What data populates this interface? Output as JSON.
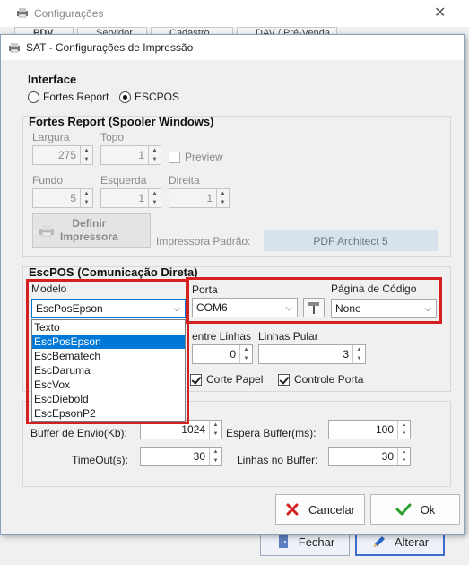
{
  "bg": {
    "title": "Configurações",
    "tabs": [
      "PDV",
      "Servidor",
      "Cadastro",
      "DAV / Pré-Venda"
    ],
    "buttons": {
      "close": "Fechar",
      "edit": "Alterar"
    }
  },
  "dialog": {
    "title": "SAT - Configurações de Impressão",
    "interface": {
      "title": "Interface",
      "options": [
        "Fortes Report",
        "ESCPOS"
      ],
      "selected": "ESCPOS"
    },
    "fortes": {
      "title": "Fortes Report (Spooler Windows)",
      "largura_label": "Largura",
      "largura": "275",
      "topo_label": "Topo",
      "topo": "1",
      "preview_label": "Preview",
      "fundo_label": "Fundo",
      "fundo": "5",
      "esquerda_label": "Esquerda",
      "esquerda": "1",
      "direita_label": "Direita",
      "direita": "1",
      "definir_label": "Definir\nImpressora",
      "padrao_label": "Impressora Padrão:",
      "padrao_value": "PDF Architect 5"
    },
    "escpos": {
      "title": "EscPOS (Comunicação Direta)",
      "modelo_label": "Modelo",
      "modelo_value": "EscPosEpson",
      "modelo_options": [
        "Texto",
        "EscPosEpson",
        "EscBematech",
        "EscDaruma",
        "EscVox",
        "EscDiebold",
        "EscEpsonP2"
      ],
      "modelo_selected_index": 1,
      "porta_label": "Porta",
      "porta_value": "COM6",
      "pagina_label": "Página de Código",
      "pagina_value": "None",
      "entre_linhas_label": "entre Linhas",
      "entre_linhas": "0",
      "linhas_pular_label": "Linhas Pular",
      "linhas_pular": "3",
      "corte_label": "Corte Papel",
      "controle_label": "Controle Porta"
    },
    "buffer": {
      "envio_label": "Buffer de Envio(Kb):",
      "envio": "1024",
      "espera_label": "Espera Buffer(ms):",
      "espera": "100",
      "timeout_label": "TimeOut(s):",
      "timeout": "30",
      "linhas_label": "Linhas no Buffer:",
      "linhas": "30"
    },
    "buttons": {
      "cancel": "Cancelar",
      "ok": "Ok"
    }
  }
}
